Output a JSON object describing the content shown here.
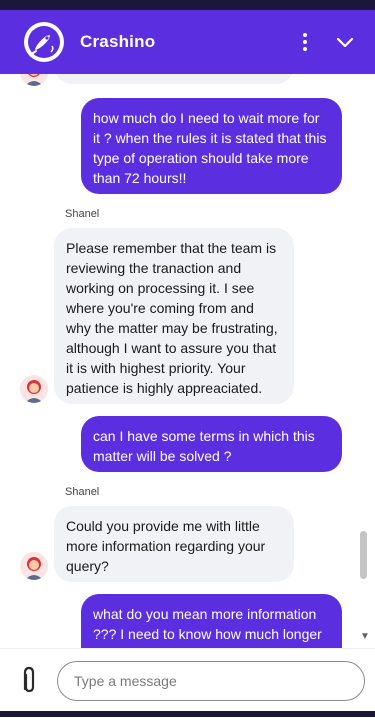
{
  "app": {
    "title": "Crashino"
  },
  "colors": {
    "brand": "#5b2ee0",
    "incoming_bg": "#f1f2f6",
    "top_strip": "#1c1638"
  },
  "messages": [
    {
      "from": "user",
      "text": "how much do I need to wait more for it ? when the rules it is stated that this type of operation should take more than 72 hours!!"
    },
    {
      "from": "agent",
      "sender": "Shanel",
      "text": "Please remember that the team is reviewing the tranaction and working on processing it. I see where you're coming from and why the matter may be frustrating, although I want to assure you that it is with highest priority. Your patience is highly appreaciated."
    },
    {
      "from": "user",
      "text": "can I have some terms in which this matter will be solved ?"
    },
    {
      "from": "agent",
      "sender": "Shanel",
      "text": "Could you provide me with little more information regarding your query?"
    },
    {
      "from": "user",
      "text": "what do you mean more information ??? I need to know how much longer"
    }
  ],
  "composer": {
    "placeholder": "Type a message"
  },
  "icons": {
    "logo": "rocket-logo-icon",
    "menu": "kebab-menu-icon",
    "collapse": "chevron-down-icon",
    "attach": "paperclip-icon"
  }
}
